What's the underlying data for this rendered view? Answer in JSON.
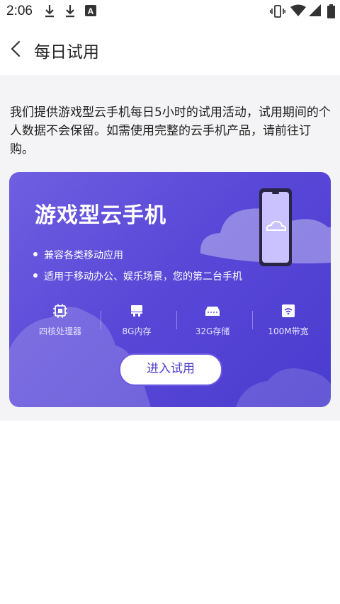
{
  "status_bar": {
    "time": "2:06",
    "icons": [
      "download-icon",
      "download-icon",
      "font-icon",
      "vibrate-icon",
      "wifi-icon",
      "signal-icon",
      "battery-icon"
    ]
  },
  "header": {
    "title": "每日试用",
    "back_icon": "chevron-left-icon"
  },
  "description": "我们提供游戏型云手机每日5小时的试用活动，试用期间的个人数据不会保留。如需使用完整的云手机产品，请前往订购。",
  "card": {
    "title": "游戏型云手机",
    "features": [
      "兼容各类移动应用",
      "适用于移动办公、娱乐场景，您的第二台手机"
    ],
    "specs": [
      {
        "icon": "cpu-icon",
        "label": "四核处理器"
      },
      {
        "icon": "memory-icon",
        "label": "8G内存"
      },
      {
        "icon": "storage-icon",
        "label": "32G存储"
      },
      {
        "icon": "wifi-icon",
        "label": "100M带宽"
      }
    ],
    "button_label": "进入试用"
  },
  "colors": {
    "card_gradient_start": "#6f5fe0",
    "card_gradient_end": "#4a3ccf",
    "button_text": "#4b3fc4",
    "content_bg": "#f4f4f6"
  }
}
